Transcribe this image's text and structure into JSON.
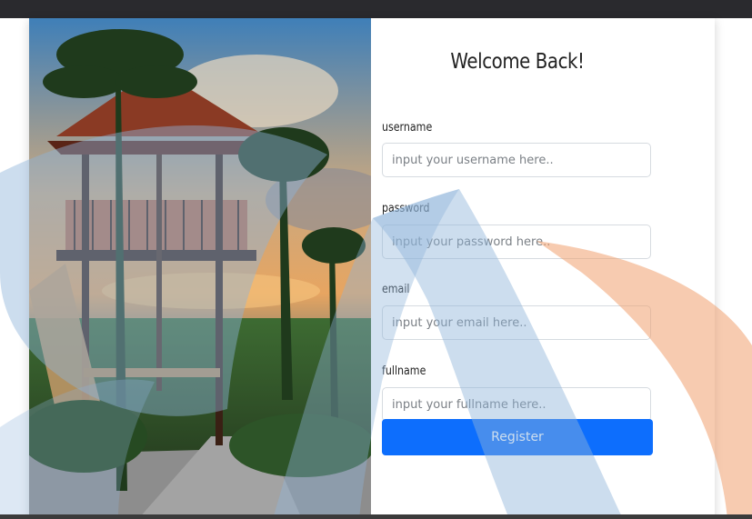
{
  "form": {
    "title": "Welcome Back!",
    "fields": [
      {
        "label": "username",
        "placeholder": "input your username here.."
      },
      {
        "label": "password",
        "placeholder": "input your password here.."
      },
      {
        "label": "email",
        "placeholder": "input your email here.."
      },
      {
        "label": "fullname",
        "placeholder": "input your fullname here.."
      }
    ],
    "submit_label": "Register"
  },
  "colors": {
    "primary_button": "#0d6efd",
    "watermark_blue": "#8fb3d9",
    "watermark_orange": "#f0a070",
    "top_bar": "#2a2a2e"
  }
}
